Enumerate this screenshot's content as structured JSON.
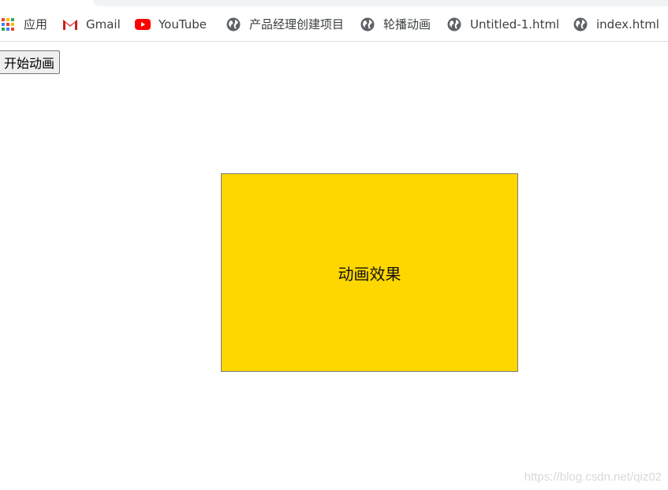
{
  "bookmarks": [
    {
      "label": "应用",
      "icon": "apps-grid-icon"
    },
    {
      "label": "Gmail",
      "icon": "gmail-icon"
    },
    {
      "label": "YouTube",
      "icon": "youtube-icon"
    },
    {
      "label": "产品经理创建项目",
      "icon": "globe-icon"
    },
    {
      "label": "轮播动画",
      "icon": "globe-icon"
    },
    {
      "label": "Untitled-1.html",
      "icon": "globe-icon"
    },
    {
      "label": "index.html",
      "icon": "globe-icon"
    }
  ],
  "page": {
    "start_button_label": "开始动画",
    "box_text": "动画效果",
    "box_color": "#ffd700"
  },
  "watermark": "https://blog.csdn.net/qiz02",
  "colors": {
    "gmail_red": "#ea4335",
    "youtube_red": "#ff0000",
    "globe_gray": "#5f6368"
  }
}
